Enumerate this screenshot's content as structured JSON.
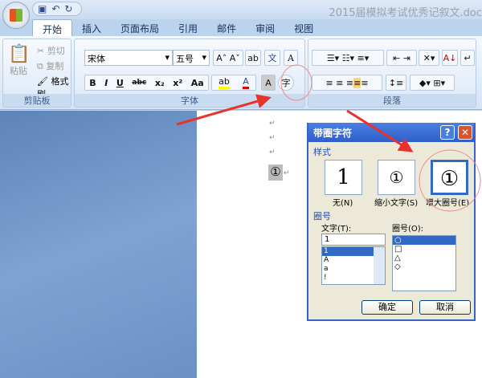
{
  "window": {
    "title": "2015届模拟考试优秀记叙文.doc",
    "qat": [
      "save-icon",
      "undo-icon",
      "redo-icon"
    ]
  },
  "tabs": [
    "开始",
    "插入",
    "页面布局",
    "引用",
    "邮件",
    "审阅",
    "视图"
  ],
  "clipboard": {
    "paste": "粘贴",
    "cut": "剪切",
    "copy": "复制",
    "format_painter": "格式刷",
    "label": "剪贴板"
  },
  "font": {
    "name": "宋体",
    "size": "五号",
    "label": "字体",
    "buttons": [
      "B",
      "I",
      "U",
      "abc",
      "x₂",
      "x²",
      "Aa",
      "A",
      "A",
      "A",
      "字"
    ]
  },
  "paragraph": {
    "label": "段落"
  },
  "document": {
    "marks": [
      "↵",
      "↵",
      "↵"
    ],
    "enclosed": "①",
    "enclosed_mark": "↵"
  },
  "dialog": {
    "title": "带圈字符",
    "help": "?",
    "close": "✕",
    "style_section": "样式",
    "styles": [
      {
        "preview": "1",
        "label": "无(N)"
      },
      {
        "preview": "①",
        "label": "缩小文字(S)"
      },
      {
        "preview": "①",
        "label": "增大圈号(E)"
      }
    ],
    "selected_style": 2,
    "enclosure_section": "圈号",
    "text_label": "文字(T):",
    "text_value": "1",
    "text_options": [
      "1",
      "A",
      "a",
      "!"
    ],
    "enclosure_label": "圈号(O):",
    "enclosure_options": [
      "○",
      "□",
      "△",
      "◇"
    ],
    "ok": "确定",
    "cancel": "取消"
  },
  "annotation_color": "#e8322c"
}
